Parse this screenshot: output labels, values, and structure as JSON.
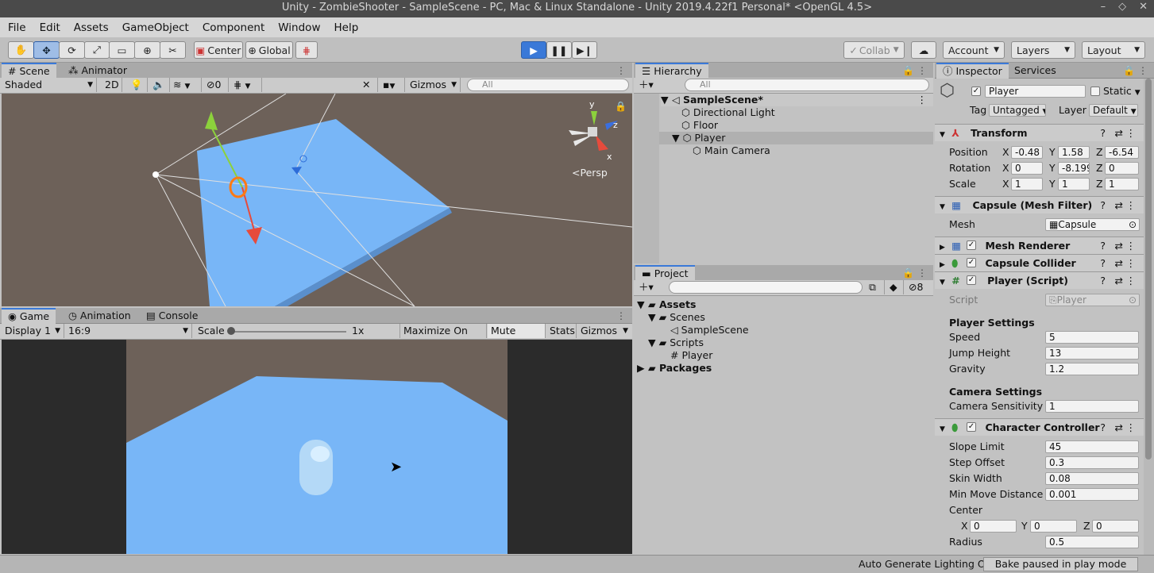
{
  "window": {
    "title": "Unity - ZombieShooter - SampleScene - PC, Mac & Linux Standalone - Unity 2019.4.22f1 Personal* <OpenGL 4.5>"
  },
  "menu": [
    "File",
    "Edit",
    "Assets",
    "GameObject",
    "Component",
    "Window",
    "Help"
  ],
  "toolbar": {
    "pivot": "Center",
    "space": "Global",
    "collab": "Collab",
    "account": "Account",
    "layers": "Layers",
    "layout": "Layout"
  },
  "scene": {
    "tab_scene": "Scene",
    "tab_animator": "Animator",
    "shading": "Shaded",
    "mode2d": "2D",
    "hidden_count": "0",
    "gizmos": "Gizmos",
    "search_placeholder": "All",
    "persp": "Persp",
    "axis_y": "y",
    "axis_z": "z",
    "axis_x": "x"
  },
  "game": {
    "tab_game": "Game",
    "tab_animation": "Animation",
    "tab_console": "Console",
    "display": "Display 1",
    "aspect": "16:9",
    "scale_label": "Scale",
    "scale_value": "1x",
    "maximize": "Maximize On Play",
    "mute": "Mute Audio",
    "stats": "Stats",
    "gizmos": "Gizmos"
  },
  "hierarchy": {
    "title": "Hierarchy",
    "search_placeholder": "All",
    "items": [
      "SampleScene*",
      "Directional Light",
      "Floor",
      "Player",
      "Main Camera"
    ]
  },
  "project": {
    "title": "Project",
    "hidden_count": "8",
    "items": [
      "Assets",
      "Scenes",
      "SampleScene",
      "Scripts",
      "Player",
      "Packages"
    ]
  },
  "inspector": {
    "tab_inspector": "Inspector",
    "tab_services": "Services",
    "object_name": "Player",
    "static_label": "Static",
    "tag_label": "Tag",
    "tag_value": "Untagged",
    "layer_label": "Layer",
    "layer_value": "Default",
    "transform": {
      "title": "Transform",
      "position_label": "Position",
      "rotation_label": "Rotation",
      "scale_label": "Scale",
      "position": [
        "-0.48",
        "1.58",
        "-6.54"
      ],
      "rotation": [
        "0",
        "-8.199",
        "0"
      ],
      "scale": [
        "1",
        "1",
        "1"
      ],
      "x": "X",
      "y": "Y",
      "z": "Z"
    },
    "mesh_filter": {
      "title": "Capsule (Mesh Filter)",
      "mesh_label": "Mesh",
      "mesh_value": "Capsule"
    },
    "mesh_renderer": {
      "title": "Mesh Renderer"
    },
    "capsule_collider": {
      "title": "Capsule Collider"
    },
    "player_script": {
      "title": "Player (Script)",
      "script_label": "Script",
      "script_value": "Player",
      "player_settings": "Player Settings",
      "speed_label": "Speed",
      "speed": "5",
      "jump_label": "Jump Height",
      "jump": "13",
      "gravity_label": "Gravity",
      "gravity": "1.2",
      "camera_settings": "Camera Settings",
      "sensitivity_label": "Camera Sensitivity",
      "sensitivity": "1"
    },
    "character_controller": {
      "title": "Character Controller",
      "slope_label": "Slope Limit",
      "slope": "45",
      "step_label": "Step Offset",
      "step": "0.3",
      "skin_label": "Skin Width",
      "skin": "0.08",
      "minmove_label": "Min Move Distance",
      "minmove": "0.001",
      "center_label": "Center",
      "center": [
        "0",
        "0",
        "0"
      ],
      "radius_label": "Radius",
      "radius": "0.5"
    }
  },
  "status": {
    "lighting": "Auto Generate Lighting Off",
    "bake": "Bake paused in play mode"
  },
  "colors": {
    "accent": "#3a79d8",
    "floor": "#78b6f7",
    "scene_bg": "#6d6159"
  }
}
